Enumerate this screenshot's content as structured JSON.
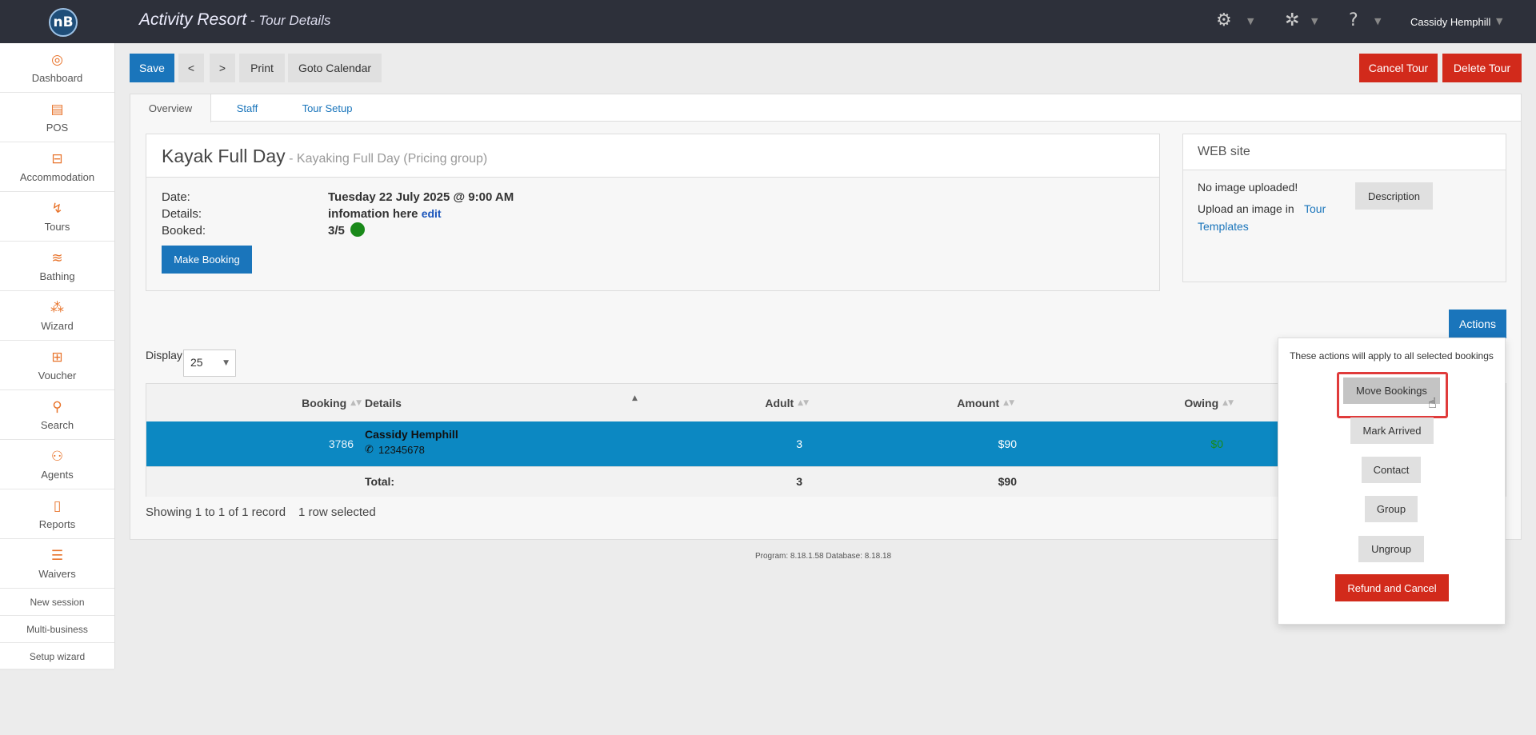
{
  "app": {
    "logo_text": "nB",
    "title": "Activity Resort",
    "separator": " - ",
    "subtitle": "Tour Details",
    "user": "Cassidy Hemphill"
  },
  "sidebar": {
    "items": [
      {
        "label": "Dashboard",
        "icon": "◎"
      },
      {
        "label": "POS",
        "icon": "▤"
      },
      {
        "label": "Accommodation",
        "icon": "⊟"
      },
      {
        "label": "Tours",
        "icon": "↯"
      },
      {
        "label": "Bathing",
        "icon": "≋"
      },
      {
        "label": "Wizard",
        "icon": "⁂"
      },
      {
        "label": "Voucher",
        "icon": "⊞"
      },
      {
        "label": "Search",
        "icon": "⚲"
      },
      {
        "label": "Agents",
        "icon": "⚇"
      },
      {
        "label": "Reports",
        "icon": "▯"
      },
      {
        "label": "Waivers",
        "icon": "☰"
      }
    ],
    "links": [
      "New session",
      "Multi-business",
      "Setup wizard"
    ]
  },
  "toolbar": {
    "save": "Save",
    "prev": "<",
    "next": ">",
    "print": "Print",
    "goto_calendar": "Goto Calendar",
    "cancel_tour": "Cancel Tour",
    "delete_tour": "Delete Tour"
  },
  "tabs": [
    "Overview",
    "Staff",
    "Tour Setup"
  ],
  "tour": {
    "name": "Kayak Full Day",
    "group": " - Kayaking Full Day (Pricing group)",
    "date_label": "Date:",
    "date_value": "Tuesday 22 July 2025 @ 9:00 AM",
    "details_label": "Details:",
    "details_value": "infomation here",
    "details_edit": "edit",
    "booked_label": "Booked:",
    "booked_value": "3/5",
    "make_booking": "Make Booking",
    "status_color": "#1a8a1a"
  },
  "web": {
    "title": "WEB site",
    "no_image": "No image uploaded!",
    "upload_text": "Upload an image in",
    "upload_link_1": "Tour",
    "upload_link_2": "Templates",
    "description_button": "Description"
  },
  "actions": {
    "button": "Actions",
    "title": "These actions will apply to all selected bookings",
    "move": "Move Bookings",
    "arrived": "Mark Arrived",
    "contact": "Contact",
    "group": "Group",
    "ungroup": "Ungroup",
    "refund": "Refund and Cancel"
  },
  "table": {
    "display_label": "Display",
    "display_value": "25",
    "headers": {
      "booking": "Booking",
      "details": "Details",
      "adult": "Adult",
      "amount": "Amount",
      "owing": "Owing"
    },
    "row": {
      "booking": "3786",
      "name": "Cassidy Hemphill",
      "phone": "12345678",
      "adult": "3",
      "amount": "$90",
      "owing": "$0"
    },
    "total_label": "Total:",
    "total_adult": "3",
    "total_amount": "$90",
    "showing": "Showing 1 to 1 of 1 record",
    "selected": "1 row selected"
  },
  "footer": {
    "version": "Program: 8.18.1.58 Database: 8.18.18"
  }
}
